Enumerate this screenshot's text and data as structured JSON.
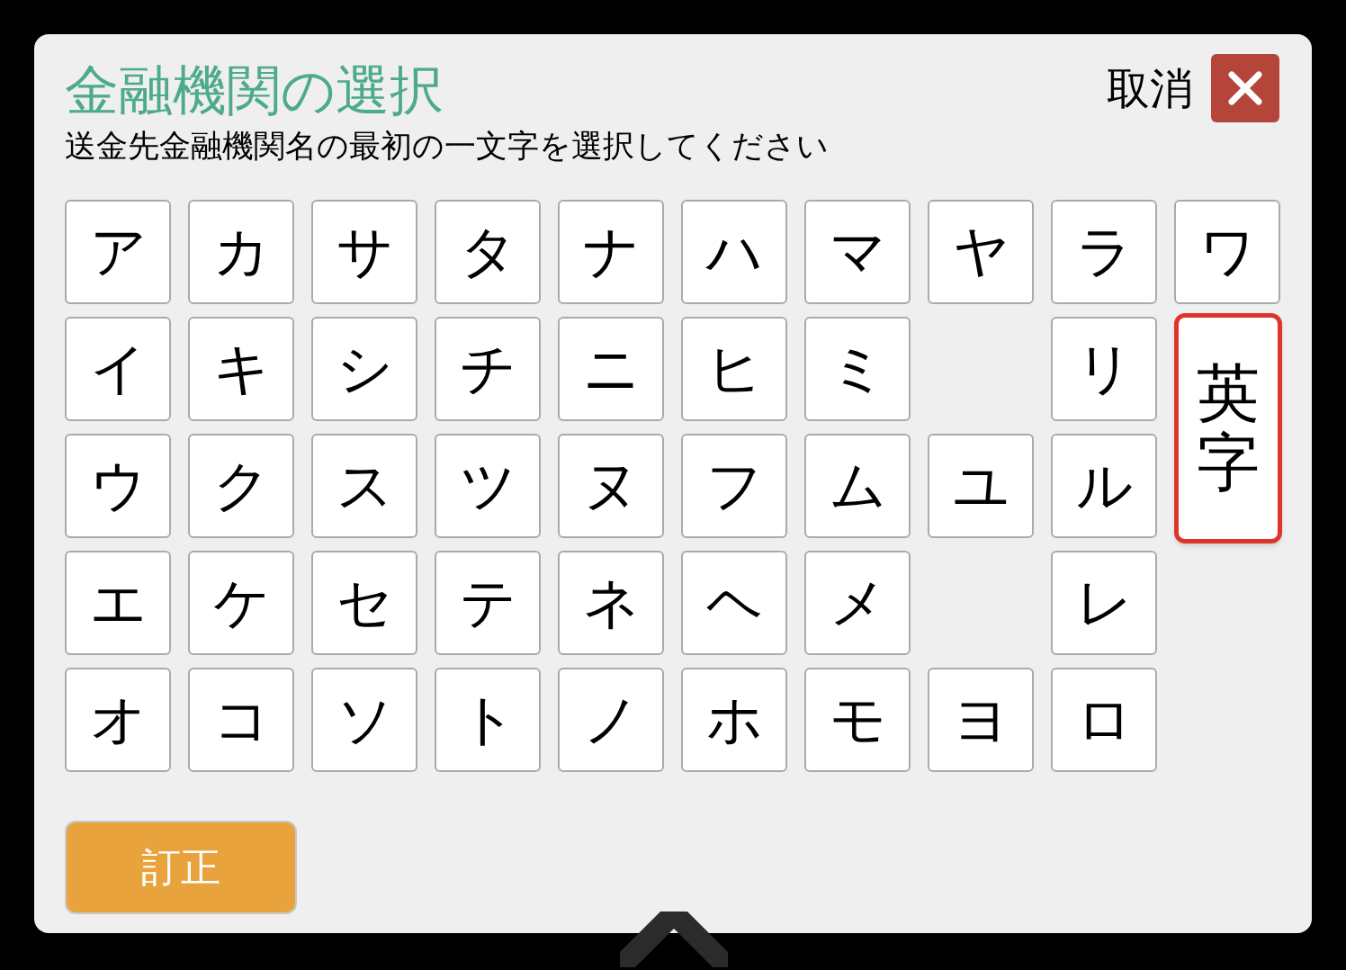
{
  "dialog": {
    "title": "金融機関の選択",
    "subtitle": "送金先金融機関名の最初の一文字を選択してください",
    "cancel_label": "取消"
  },
  "columns": [
    [
      {
        "label": "ア",
        "kind": "key",
        "selected": false
      },
      {
        "label": "イ",
        "kind": "key",
        "selected": false
      },
      {
        "label": "ウ",
        "kind": "key",
        "selected": false
      },
      {
        "label": "エ",
        "kind": "key",
        "selected": false
      },
      {
        "label": "オ",
        "kind": "key",
        "selected": false
      }
    ],
    [
      {
        "label": "カ",
        "kind": "key",
        "selected": false
      },
      {
        "label": "キ",
        "kind": "key",
        "selected": false
      },
      {
        "label": "ク",
        "kind": "key",
        "selected": false
      },
      {
        "label": "ケ",
        "kind": "key",
        "selected": false
      },
      {
        "label": "コ",
        "kind": "key",
        "selected": false
      }
    ],
    [
      {
        "label": "サ",
        "kind": "key",
        "selected": false
      },
      {
        "label": "シ",
        "kind": "key",
        "selected": false
      },
      {
        "label": "ス",
        "kind": "key",
        "selected": false
      },
      {
        "label": "セ",
        "kind": "key",
        "selected": false
      },
      {
        "label": "ソ",
        "kind": "key",
        "selected": false
      }
    ],
    [
      {
        "label": "タ",
        "kind": "key",
        "selected": false
      },
      {
        "label": "チ",
        "kind": "key",
        "selected": false
      },
      {
        "label": "ツ",
        "kind": "key",
        "selected": false
      },
      {
        "label": "テ",
        "kind": "key",
        "selected": false
      },
      {
        "label": "ト",
        "kind": "key",
        "selected": false
      }
    ],
    [
      {
        "label": "ナ",
        "kind": "key",
        "selected": false
      },
      {
        "label": "ニ",
        "kind": "key",
        "selected": false
      },
      {
        "label": "ヌ",
        "kind": "key",
        "selected": false
      },
      {
        "label": "ネ",
        "kind": "key",
        "selected": false
      },
      {
        "label": "ノ",
        "kind": "key",
        "selected": false
      }
    ],
    [
      {
        "label": "ハ",
        "kind": "key",
        "selected": false
      },
      {
        "label": "ヒ",
        "kind": "key",
        "selected": false
      },
      {
        "label": "フ",
        "kind": "key",
        "selected": false
      },
      {
        "label": "ヘ",
        "kind": "key",
        "selected": false
      },
      {
        "label": "ホ",
        "kind": "key",
        "selected": false
      }
    ],
    [
      {
        "label": "マ",
        "kind": "key",
        "selected": false
      },
      {
        "label": "ミ",
        "kind": "key",
        "selected": false
      },
      {
        "label": "ム",
        "kind": "key",
        "selected": false
      },
      {
        "label": "メ",
        "kind": "key",
        "selected": false
      },
      {
        "label": "モ",
        "kind": "key",
        "selected": false
      }
    ],
    [
      {
        "label": "ヤ",
        "kind": "key",
        "selected": false
      },
      {
        "kind": "gap"
      },
      {
        "label": "ユ",
        "kind": "key",
        "selected": false
      },
      {
        "kind": "gap"
      },
      {
        "label": "ヨ",
        "kind": "key",
        "selected": false
      }
    ],
    [
      {
        "label": "ラ",
        "kind": "key",
        "selected": false
      },
      {
        "label": "リ",
        "kind": "key",
        "selected": false
      },
      {
        "label": "ル",
        "kind": "key",
        "selected": false
      },
      {
        "label": "レ",
        "kind": "key",
        "selected": false
      },
      {
        "label": "ロ",
        "kind": "key",
        "selected": false
      }
    ],
    [
      {
        "label": "ワ",
        "kind": "key",
        "selected": false
      },
      {
        "label": "英字",
        "kind": "tall",
        "selected": true
      }
    ]
  ],
  "correct_button": "訂正"
}
